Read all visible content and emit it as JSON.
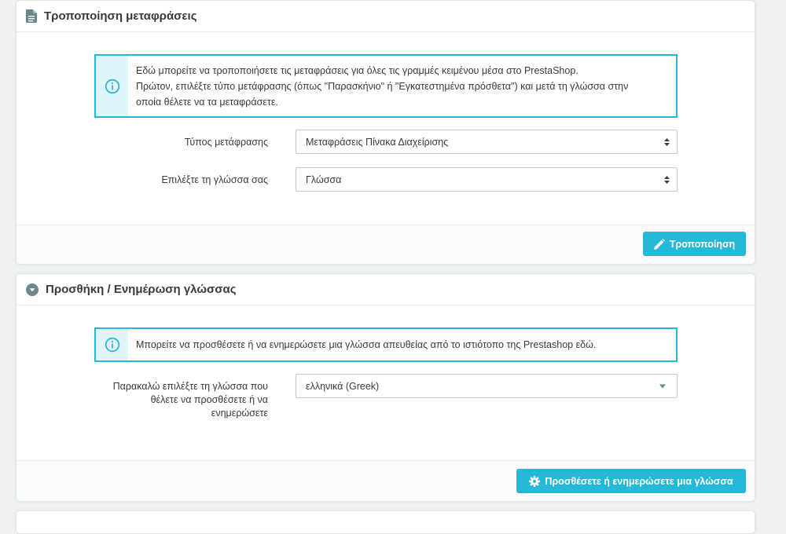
{
  "translations_panel": {
    "title": "Τροποποίηση μεταφράσεις",
    "alert_line1": "Εδώ μπορείτε να τροποποιήσετε τις μεταφράσεις για όλες τις γραμμές κειμένου μέσα στο PrestaShop.",
    "alert_line2": "Πρώτον, επιλέξτε τύπο μετάφρασης (όπως \"Παρασκήνιο\" ή \"Εγκατεστημένα πρόσθετα\") και μετά τη γλώσσα στην",
    "alert_line3": "οποία θέλετε να τα μεταφράσετε.",
    "type_label": "Τύπος μετάφρασης",
    "type_value": "Μεταφράσεις Πίνακα Διαχείρισης",
    "language_label": "Επιλέξτε τη γλώσσα σας",
    "language_value": "Γλώσσα",
    "modify_button": "Τροποποίηση"
  },
  "add_language_panel": {
    "title": "Προσθήκη / Ενημέρωση γλώσσας",
    "alert_text": "Μπορείτε να προσθέσετε ή να ενημερώσετε μια γλώσσα απευθείας από το ιστιότοπο της Prestashop εδώ.",
    "language_label_line1": "Παρακαλώ επιλέξτε τη γλώσσα που",
    "language_label_line2": "θέλετε να προσθέσετε ή να",
    "language_label_line3": "ενημερώσετε",
    "language_value": "ελληνικά (Greek)",
    "submit_button": "Προσθέσετε ή ενημερώσετε μια γλώσσα"
  },
  "colors": {
    "accent": "#25b9d7",
    "heading_icon": "#6c868e"
  }
}
